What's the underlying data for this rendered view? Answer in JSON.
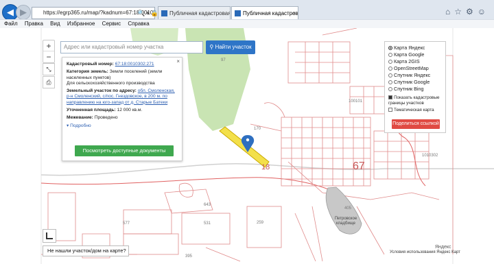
{
  "browser": {
    "address": "https://egrp365.ru/map/?kadnum=67:18:0010302:2",
    "tabs": [
      {
        "label": "Публичная кадастровая карта..."
      },
      {
        "label": "Публичная кадастровая карта"
      }
    ],
    "menu": [
      "Файл",
      "Правка",
      "Вид",
      "Избранное",
      "Сервис",
      "Справка"
    ]
  },
  "search": {
    "placeholder": "Адрес или кадастровый номер участка",
    "button": "Найти участок"
  },
  "info": {
    "kadnum_label": "Кадастровый номер:",
    "kadnum_value": "67:18:0010302:271",
    "category_label": "Категория земель:",
    "category_value": "Земли поселений (земли населенных пунктов)",
    "use_value": "Для сельскохозяйственного производства",
    "address_label": "Земельный участок по адресу:",
    "address_value": "обл. Смоленская, р-н Смоленский, с/пос. Гнездовское, в 200 м. по направлению на юго-запад от д. Старые Батеки",
    "area_label": "Уточненная площадь:",
    "area_value": "12 000 кв.м.",
    "survey_label": "Межевание:",
    "survey_value": "Проведено",
    "more": "Подробно",
    "docs_button": "Посмотреть доступные документы"
  },
  "layers": {
    "options": [
      {
        "label": "Карта Яндекс",
        "selected": true
      },
      {
        "label": "Карта Google",
        "selected": false
      },
      {
        "label": "Карта 2GIS",
        "selected": false
      },
      {
        "label": "OpenStreetMap",
        "selected": false
      },
      {
        "label": "Спутник Яндекс",
        "selected": false
      },
      {
        "label": "Спутник Google",
        "selected": false
      },
      {
        "label": "Спутник Bing",
        "selected": false
      }
    ],
    "show_borders": "Показать кадастровые границы участков",
    "thematic": "Тематическая карта",
    "share": "Поделиться ссылкой"
  },
  "map_labels": {
    "big_number": "67",
    "number_18": "18",
    "cemetery": "Петровское кладбище",
    "yandex": "Яндекс",
    "yandex_terms": "Условия использования Яндекс Карт",
    "parcel_numbers": [
      "97",
      "170",
      "643",
      "577",
      "531",
      "259",
      "395",
      "100101",
      "1010302",
      "405"
    ]
  },
  "bottom_bar": "Не нашли участок/дом на карте?",
  "colors": {
    "parcel_red": "#e08a8a",
    "highlight_yellow": "#f3e04a",
    "forest_green": "#c9e4b3",
    "search_blue": "#2e75c7",
    "docs_green": "#3fa84f",
    "share_red": "#e04a43"
  }
}
